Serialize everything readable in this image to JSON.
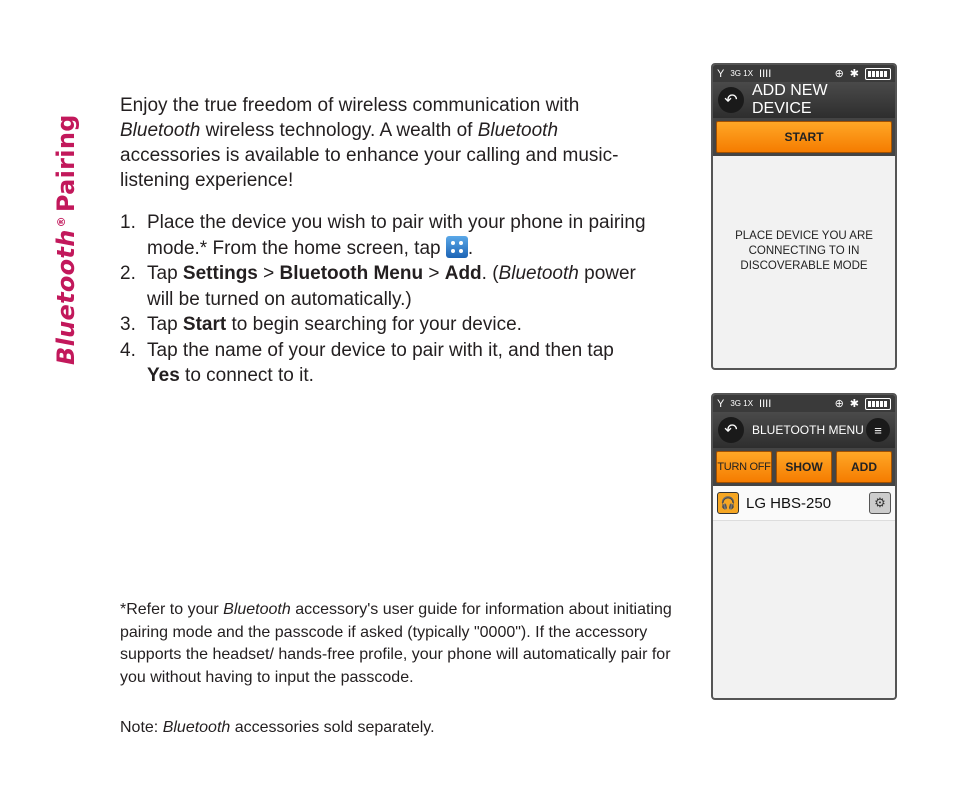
{
  "side_title": {
    "italic": "Bluetooth",
    "reg": "®",
    "rest": "Pairing"
  },
  "intro": {
    "t1": "Enjoy the true freedom of wireless communication with ",
    "i1": "Bluetooth",
    "t2": " wireless technology. A wealth of ",
    "i2": "Bluetooth",
    "t3": " accessories is available to enhance your calling and music-listening experience!"
  },
  "steps": [
    {
      "num": "1.",
      "t1": "Place the device you wish to pair with your phone in pairing mode.* From the home screen, tap ",
      "t2": "."
    },
    {
      "num": "2.",
      "t1": "Tap ",
      "b1": "Settings",
      "t2": " > ",
      "b2": "Bluetooth Menu",
      "t3": " > ",
      "b3": "Add",
      "t4": ". (",
      "i1": "Bluetooth",
      "t5": " power will be turned on automatically.)"
    },
    {
      "num": "3.",
      "t1": "Tap ",
      "b1": "Start",
      "t2": " to begin searching for your device."
    },
    {
      "num": "4.",
      "t1": "Tap the name of your device to pair with it, and then tap ",
      "b1": "Yes",
      "t2": " to connect to it."
    }
  ],
  "footnote": {
    "t1": "*Refer to your ",
    "i1": "Bluetooth",
    "t2": " accessory's user guide for information about initiating pairing mode and the passcode if asked (typically \"0000\"). If the accessory supports the headset/ hands-free profile, your phone will automatically pair for you without having to input the passcode."
  },
  "note": {
    "t1": "Note: ",
    "i1": "Bluetooth",
    "t2": " accessories sold separately."
  },
  "status": {
    "signal": "Y",
    "network": "3G 1X",
    "bars": "IIII",
    "gps": "⊕",
    "bt": "✱"
  },
  "screen1": {
    "title": "ADD NEW DEVICE",
    "start_label": "START",
    "message_lines": [
      "PLACE DEVICE YOU ARE",
      "CONNECTING TO IN",
      "DISCOVERABLE MODE"
    ]
  },
  "screen2": {
    "title": "BLUETOOTH MENU",
    "buttons": [
      "TURN OFF",
      "SHOW",
      "ADD"
    ],
    "device_name": "LG HBS-250"
  }
}
